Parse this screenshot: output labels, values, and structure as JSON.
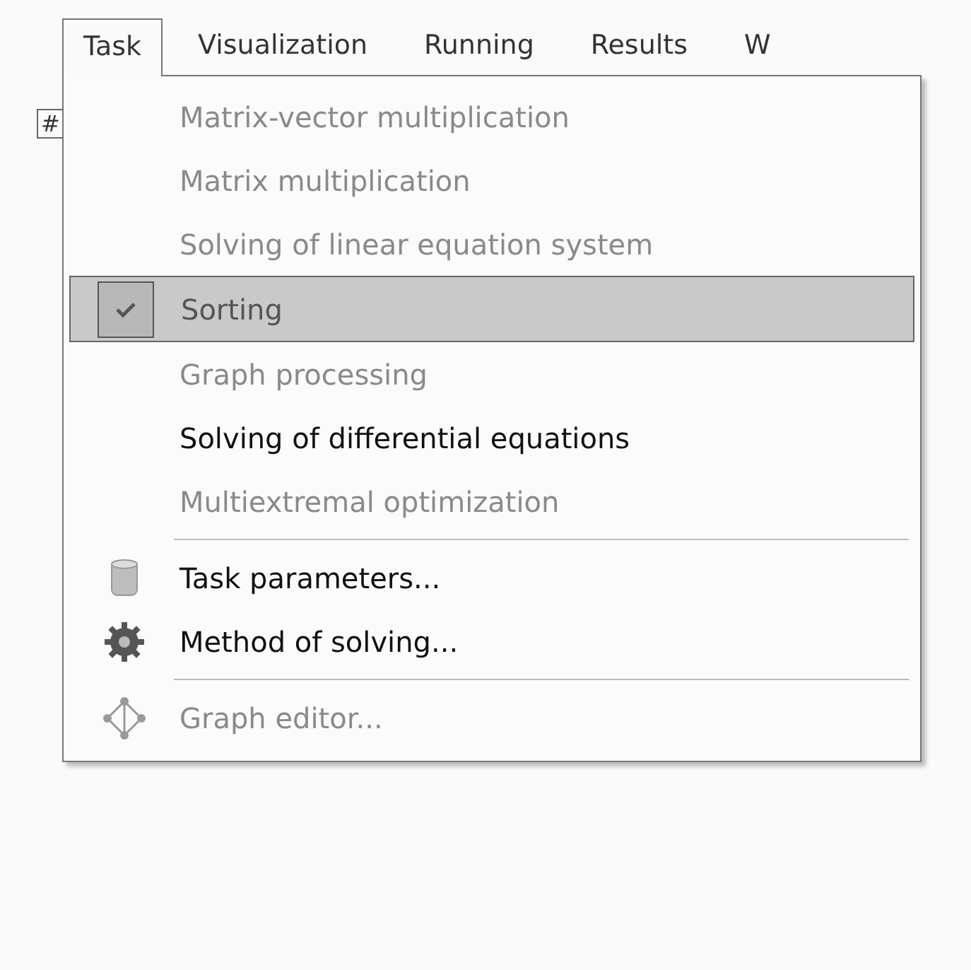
{
  "menubar": {
    "toolbar_fragment": "#",
    "menus": [
      {
        "label": "Task",
        "selected": true
      },
      {
        "label": "Visualization",
        "selected": false
      },
      {
        "label": "Running",
        "selected": false
      },
      {
        "label": "Results",
        "selected": false
      },
      {
        "label": "W",
        "selected": false
      }
    ]
  },
  "dropdown": {
    "items": [
      {
        "kind": "item",
        "label": "Matrix-vector multiplication",
        "disabled": true,
        "checked": false
      },
      {
        "kind": "item",
        "label": "Matrix multiplication",
        "disabled": true,
        "checked": false
      },
      {
        "kind": "item",
        "label": "Solving of linear equation system",
        "disabled": true,
        "checked": false
      },
      {
        "kind": "item",
        "label": "Sorting",
        "disabled": true,
        "checked": true
      },
      {
        "kind": "item",
        "label": "Graph processing",
        "disabled": true,
        "checked": false
      },
      {
        "kind": "item",
        "label": "Solving of differential equations",
        "disabled": false,
        "checked": false
      },
      {
        "kind": "item",
        "label": "Multiextremal optimization",
        "disabled": true,
        "checked": false
      },
      {
        "kind": "separator"
      },
      {
        "kind": "cylinder_item",
        "label": "Task parameters...",
        "disabled": false,
        "checked": false
      },
      {
        "kind": "gear_item",
        "label": "Method of solving...",
        "disabled": false,
        "checked": false
      },
      {
        "kind": "separator"
      },
      {
        "kind": "graph_item",
        "label": "Graph editor...",
        "disabled": true,
        "checked": false
      }
    ]
  }
}
